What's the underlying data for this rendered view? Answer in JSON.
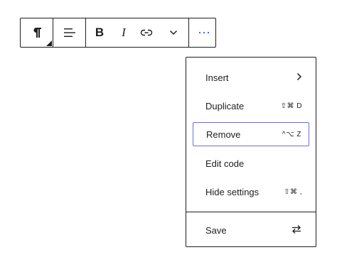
{
  "toolbar": {
    "paragraph_icon": "pilcrow-icon",
    "align_icon": "align-left-icon",
    "bold_label": "B",
    "italic_label": "I",
    "link_icon": "link-icon",
    "more_rich_text_icon": "chevron-down-icon",
    "options_icon": "more-horizontal-icon",
    "accent_color": "#3858e9"
  },
  "menu": {
    "items": [
      {
        "label": "Insert",
        "shortcut": "",
        "icon": "chevron-right-icon"
      },
      {
        "label": "Duplicate",
        "shortcut": "⇧⌘ D"
      },
      {
        "label": "Remove",
        "shortcut": "^⌥ Z",
        "focused": true
      },
      {
        "label": "Edit code",
        "shortcut": ""
      },
      {
        "label": "Hide settings",
        "shortcut": "⇧⌘ ,"
      }
    ],
    "footer": {
      "label": "Save",
      "icon": "sync-arrows-icon"
    },
    "focus_color": "#6b6fd6"
  }
}
